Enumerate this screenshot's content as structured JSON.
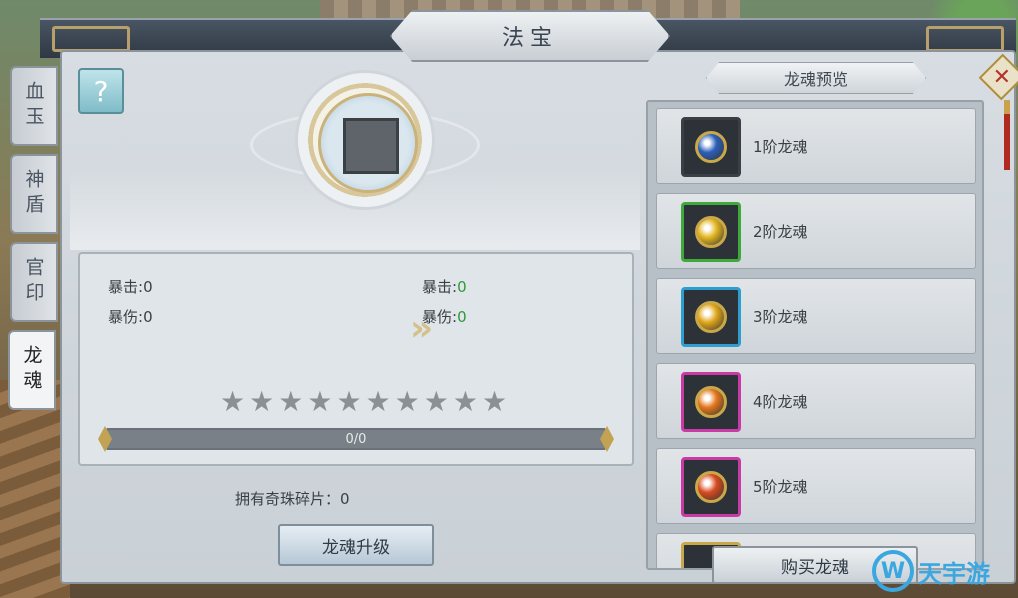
{
  "window": {
    "title": "法宝"
  },
  "side_tabs": [
    {
      "label": "血玉",
      "active": false
    },
    {
      "label": "神盾",
      "active": false
    },
    {
      "label": "官印",
      "active": false
    },
    {
      "label": "龙魂",
      "active": true
    }
  ],
  "help": {
    "icon": "question-icon",
    "label": "?"
  },
  "close": {
    "icon": "close-icon",
    "label": "✕"
  },
  "stats": {
    "current": {
      "crit_label": "暴击:",
      "crit_value": "0",
      "critdmg_label": "暴伤:",
      "critdmg_value": "0"
    },
    "next": {
      "crit_label": "暴击:",
      "crit_value": "0",
      "critdmg_label": "暴伤:",
      "critdmg_value": "0"
    },
    "stars_total": 10,
    "stars_filled": 0,
    "progress_text": "0/0",
    "progress_fraction": 0
  },
  "fragments": {
    "text": "拥有奇珠碎片：0"
  },
  "upgrade_button": {
    "label": "龙魂升级"
  },
  "preview": {
    "header": "龙魂预览",
    "items": [
      {
        "name": "1阶龙魂",
        "border": "#3a3f45",
        "gem": "#2a5fb8"
      },
      {
        "name": "2阶龙魂",
        "border": "#3fa93c",
        "gem": "#e3b51f"
      },
      {
        "name": "3阶龙魂",
        "border": "#2c9fd0",
        "gem": "#e0a61a"
      },
      {
        "name": "4阶龙魂",
        "border": "#c93aa6",
        "gem": "#e3761a"
      },
      {
        "name": "5阶龙魂",
        "border": "#c93aa6",
        "gem": "#d84a1f"
      }
    ]
  },
  "buy_button": {
    "label": "购买龙魂"
  },
  "watermark": {
    "text": "天宇游"
  }
}
